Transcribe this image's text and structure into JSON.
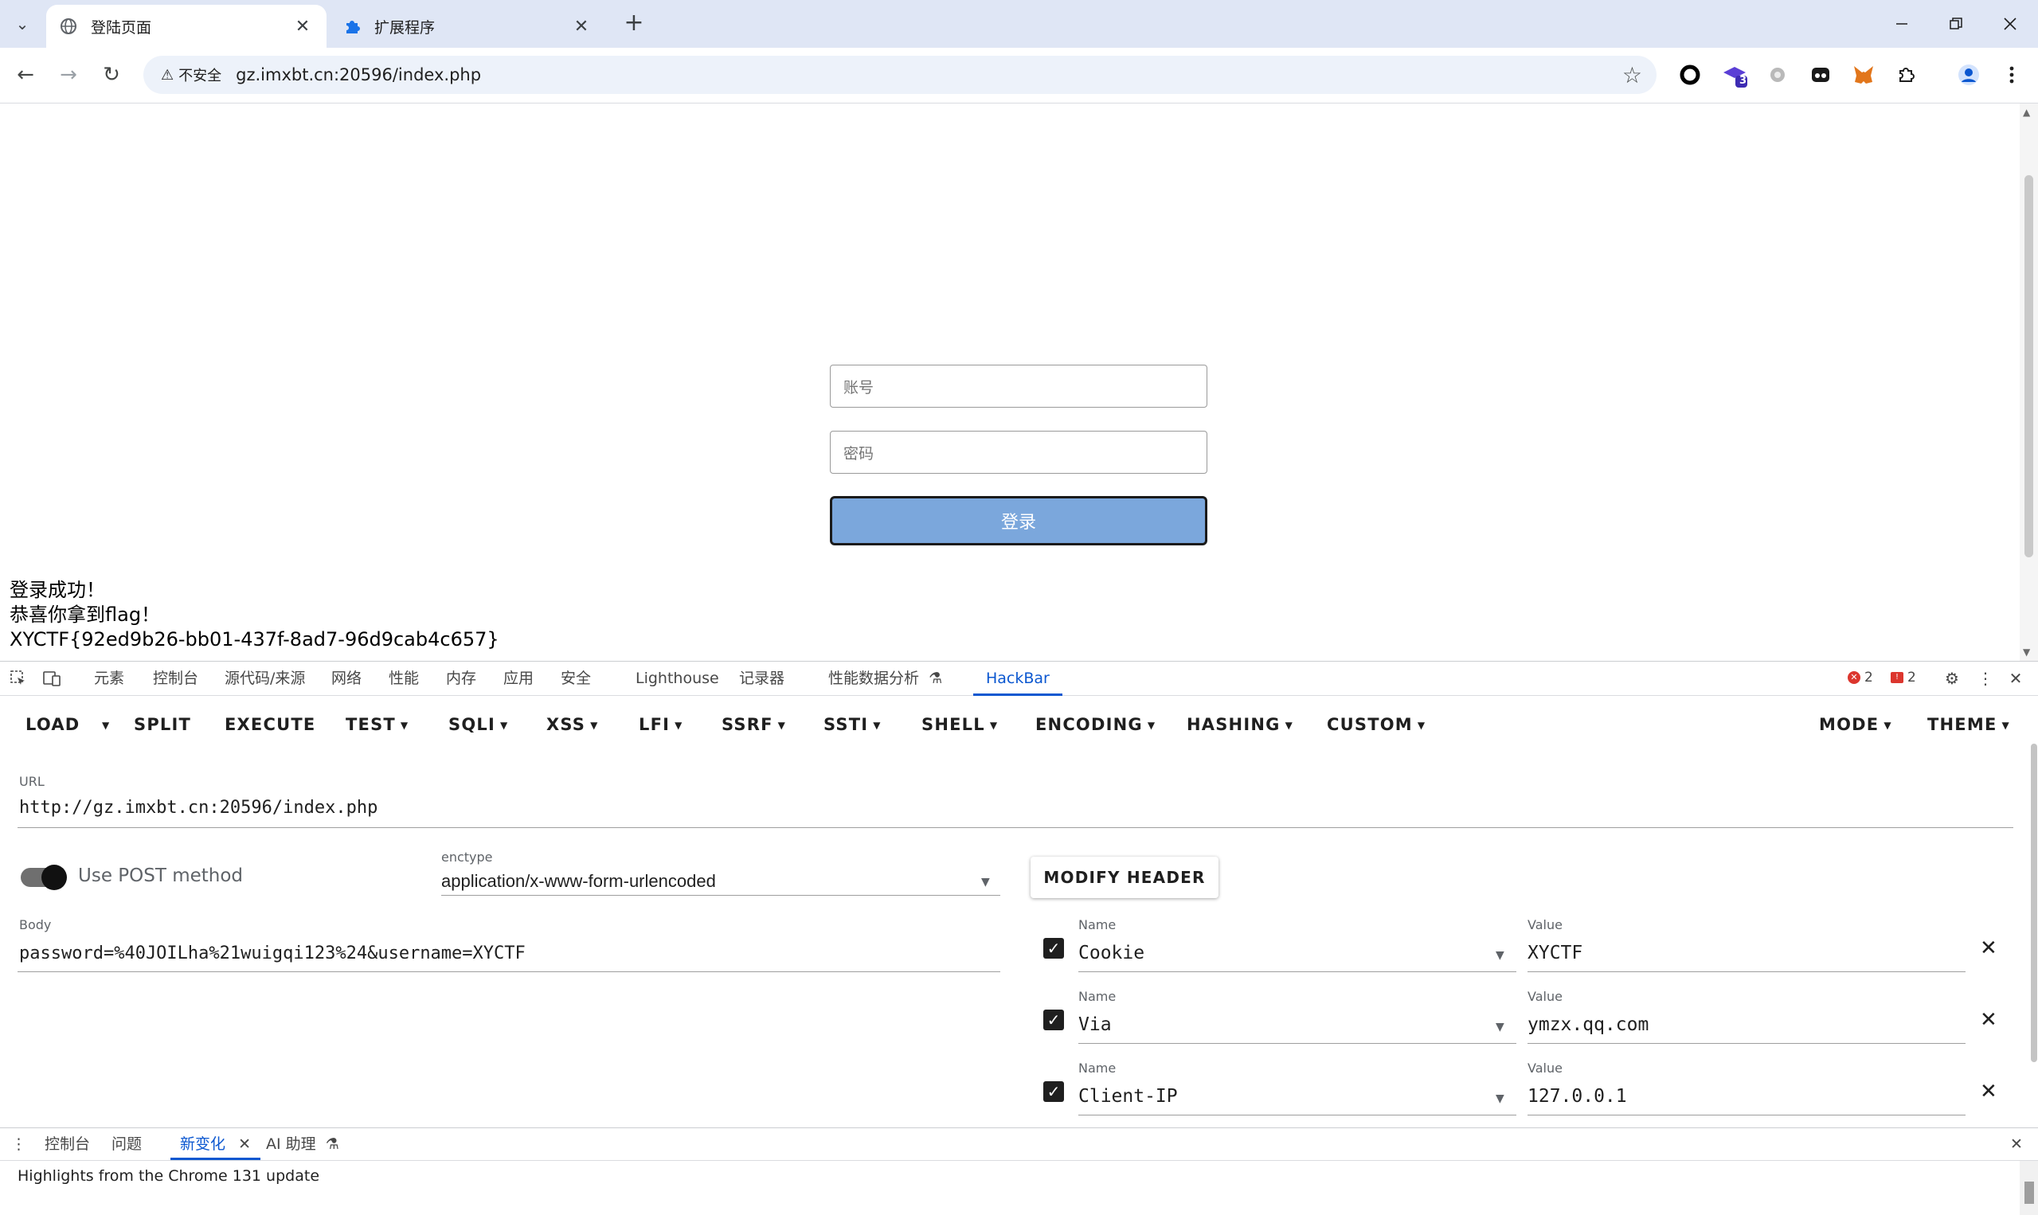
{
  "browser": {
    "tabs": [
      {
        "title": "登陆页面",
        "icon": "globe-icon",
        "active": true
      },
      {
        "title": "扩展程序",
        "icon": "puzzle-icon",
        "active": false
      }
    ],
    "address": {
      "security_label": "不安全",
      "url": "gz.imxbt.cn:20596/index.php"
    },
    "extension_badge": "3"
  },
  "page": {
    "account_placeholder": "账号",
    "password_placeholder": "密码",
    "login_button": "登录",
    "messages": [
      "登录成功！",
      "恭喜你拿到flag！",
      "XYCTF{92ed9b26-bb01-437f-8ad7-96d9cab4c657}"
    ]
  },
  "devtools": {
    "tabs": [
      "元素",
      "控制台",
      "源代码/来源",
      "网络",
      "性能",
      "内存",
      "应用",
      "安全",
      "Lighthouse",
      "记录器",
      "性能数据分析",
      "HackBar"
    ],
    "active_tab": "HackBar",
    "error_count": "2",
    "issue_count": "2"
  },
  "hackbar": {
    "menu": [
      "LOAD",
      "SPLIT",
      "EXECUTE",
      "TEST",
      "SQLI",
      "XSS",
      "LFI",
      "SSRF",
      "SSTI",
      "SHELL",
      "ENCODING",
      "HASHING",
      "CUSTOM",
      "MODE",
      "THEME"
    ],
    "url_label": "URL",
    "url": "http://gz.imxbt.cn:20596/index.php",
    "post_label": "Use POST method",
    "post_enabled": true,
    "enctype_label": "enctype",
    "enctype": "application/x-www-form-urlencoded",
    "body_label": "Body",
    "body": "password=%40JOILha%21wuigqi123%24&username=XYCTF",
    "modify_header": "MODIFY HEADER",
    "name_label": "Name",
    "value_label": "Value",
    "headers": [
      {
        "name": "Cookie",
        "value": "XYCTF",
        "enabled": true
      },
      {
        "name": "Via",
        "value": "ymzx.qq.com",
        "enabled": true
      },
      {
        "name": "Client-IP",
        "value": "127.0.0.1",
        "enabled": true
      }
    ]
  },
  "drawer": {
    "tabs": [
      "控制台",
      "问题",
      "新变化",
      "AI 助理"
    ],
    "active_tab": "新变化",
    "content": "Highlights from the Chrome 131 update"
  }
}
